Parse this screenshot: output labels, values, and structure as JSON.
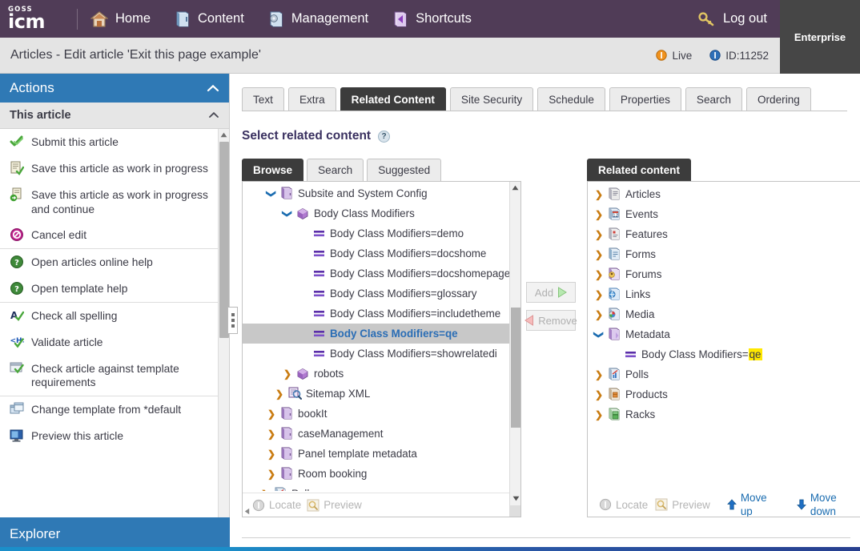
{
  "brand": {
    "line1": "GOSS",
    "line2": "icm"
  },
  "topnav": {
    "items": [
      {
        "label": "Home",
        "icon": "home-icon"
      },
      {
        "label": "Content",
        "icon": "content-book-icon"
      },
      {
        "label": "Management",
        "icon": "management-gear-icon"
      },
      {
        "label": "Shortcuts",
        "icon": "shortcuts-arrow-icon"
      }
    ],
    "logout": {
      "label": "Log out",
      "icon": "key-icon"
    },
    "edition": "Enterprise"
  },
  "titlebar": {
    "title": "Articles - Edit article 'Exit this page example'",
    "status": {
      "label": "Live",
      "icon": "live-info-icon"
    },
    "id": {
      "label": "ID:11252",
      "icon": "id-info-icon"
    }
  },
  "sidebar": {
    "header": "Actions",
    "group_header": "This article",
    "footer_header": "Explorer",
    "items": [
      {
        "label": "Submit this article",
        "icon": "green-check-icon",
        "divider_before": false
      },
      {
        "label": "Save this article as work in progress",
        "icon": "save-wip-icon",
        "divider_before": false
      },
      {
        "label": "Save this article as work in progress and continue",
        "icon": "save-wip-continue-icon",
        "divider_before": false
      },
      {
        "label": "Cancel edit",
        "icon": "cancel-icon",
        "divider_before": false
      },
      {
        "label": "Open articles online help",
        "icon": "help-icon",
        "divider_before": true
      },
      {
        "label": "Open template help",
        "icon": "help-icon",
        "divider_before": false
      },
      {
        "label": "Check all spelling",
        "icon": "spellcheck-icon",
        "divider_before": true
      },
      {
        "label": "Validate article",
        "icon": "validate-html-icon",
        "divider_before": false
      },
      {
        "label": "Check article against template requirements",
        "icon": "template-check-icon",
        "divider_before": false
      },
      {
        "label": "Change template from *default",
        "icon": "change-template-icon",
        "divider_before": true
      },
      {
        "label": "Preview this article",
        "icon": "preview-monitor-icon",
        "divider_before": false
      }
    ]
  },
  "main": {
    "tabs": [
      {
        "label": "Text",
        "active": false
      },
      {
        "label": "Extra",
        "active": false
      },
      {
        "label": "Related Content",
        "active": true
      },
      {
        "label": "Site Security",
        "active": false
      },
      {
        "label": "Schedule",
        "active": false
      },
      {
        "label": "Properties",
        "active": false
      },
      {
        "label": "Search",
        "active": false
      },
      {
        "label": "Ordering",
        "active": false
      }
    ],
    "section_title": "Select related content",
    "help_marker": "?",
    "browse_tabs": [
      {
        "label": "Browse",
        "active": true
      },
      {
        "label": "Search",
        "active": false
      },
      {
        "label": "Suggested",
        "active": false
      }
    ],
    "browse_tree": [
      {
        "label": "Subsite and System Config",
        "indent": 1,
        "caret": "down",
        "icon": "folder-door-icon",
        "selected": false
      },
      {
        "label": "Body Class Modifiers",
        "indent": 2,
        "caret": "down",
        "icon": "metadata-cube-icon",
        "selected": false
      },
      {
        "label": "Body Class Modifiers=demo",
        "indent": 3,
        "caret": "none",
        "icon": "metadata-value-icon",
        "selected": false
      },
      {
        "label": "Body Class Modifiers=docshome",
        "indent": 3,
        "caret": "none",
        "icon": "metadata-value-icon",
        "selected": false
      },
      {
        "label": "Body Class Modifiers=docshomepage",
        "indent": 3,
        "caret": "none",
        "icon": "metadata-value-icon",
        "selected": false
      },
      {
        "label": "Body Class Modifiers=glossary",
        "indent": 3,
        "caret": "none",
        "icon": "metadata-value-icon",
        "selected": false
      },
      {
        "label": "Body Class Modifiers=includetheme",
        "indent": 3,
        "caret": "none",
        "icon": "metadata-value-icon",
        "selected": false
      },
      {
        "label": "Body Class Modifiers=qe",
        "indent": 3,
        "caret": "none",
        "icon": "metadata-value-icon",
        "selected": true
      },
      {
        "label": "Body Class Modifiers=showrelatedi",
        "indent": 3,
        "caret": "none",
        "icon": "metadata-value-icon",
        "selected": false
      },
      {
        "label": "robots",
        "indent": 2,
        "caret": "right",
        "icon": "metadata-cube-icon",
        "selected": false
      },
      {
        "label": "Sitemap XML",
        "indent": 1.5,
        "caret": "right",
        "icon": "sitemap-icon",
        "selected": false
      },
      {
        "label": "bookIt",
        "indent": 1,
        "caret": "right",
        "icon": "folder-door-icon",
        "selected": false
      },
      {
        "label": "caseManagement",
        "indent": 1,
        "caret": "right",
        "icon": "folder-door-icon",
        "selected": false
      },
      {
        "label": "Panel template metadata",
        "indent": 1,
        "caret": "right",
        "icon": "folder-door-icon",
        "selected": false
      },
      {
        "label": "Room booking",
        "indent": 1,
        "caret": "right",
        "icon": "folder-door-icon",
        "selected": false
      },
      {
        "label": "Polls",
        "indent": 0.6,
        "caret": "right",
        "icon": "polls-icon",
        "selected": false
      }
    ],
    "browse_footer": [
      {
        "label": "Locate",
        "icon": "locate-icon",
        "enabled": false
      },
      {
        "label": "Preview",
        "icon": "preview-icon",
        "enabled": false
      }
    ],
    "transfer": [
      {
        "label": "Add",
        "icon": "arrow-right-icon",
        "enabled": false
      },
      {
        "label": "Remove",
        "icon": "arrow-left-icon",
        "enabled": false
      }
    ],
    "related_tab": "Related content",
    "related_tree": [
      {
        "label": "Articles",
        "indent": 0,
        "caret": "right",
        "icon": "articles-icon",
        "highlight": ""
      },
      {
        "label": "Events",
        "indent": 0,
        "caret": "right",
        "icon": "events-icon",
        "highlight": ""
      },
      {
        "label": "Features",
        "indent": 0,
        "caret": "right",
        "icon": "features-icon",
        "highlight": ""
      },
      {
        "label": "Forms",
        "indent": 0,
        "caret": "right",
        "icon": "forms-icon",
        "highlight": ""
      },
      {
        "label": "Forums",
        "indent": 0,
        "caret": "right",
        "icon": "forums-icon",
        "highlight": ""
      },
      {
        "label": "Links",
        "indent": 0,
        "caret": "right",
        "icon": "links-icon",
        "highlight": ""
      },
      {
        "label": "Media",
        "indent": 0,
        "caret": "right",
        "icon": "media-icon",
        "highlight": ""
      },
      {
        "label": "Metadata",
        "indent": 0,
        "caret": "down",
        "icon": "metadata-folder-icon",
        "highlight": ""
      },
      {
        "label": "Body Class Modifiers=",
        "indent": 1,
        "caret": "none",
        "icon": "metadata-value-icon",
        "highlight": "qe"
      },
      {
        "label": "Polls",
        "indent": 0,
        "caret": "right",
        "icon": "polls-icon",
        "highlight": ""
      },
      {
        "label": "Products",
        "indent": 0,
        "caret": "right",
        "icon": "products-icon",
        "highlight": ""
      },
      {
        "label": "Racks",
        "indent": 0,
        "caret": "right",
        "icon": "racks-icon",
        "highlight": ""
      }
    ],
    "related_footer": [
      {
        "label": "Locate",
        "icon": "locate-icon",
        "enabled": false
      },
      {
        "label": "Preview",
        "icon": "preview-icon",
        "enabled": false
      },
      {
        "label": "Move up",
        "icon": "arrow-up-icon",
        "enabled": true
      },
      {
        "label": "Move down",
        "icon": "arrow-down-icon",
        "enabled": true
      }
    ]
  },
  "colors": {
    "topnav": "#503c57",
    "accent_blue": "#2f79b5",
    "active_tab": "#3c3c3c",
    "highlight": "#ffe800",
    "selected_row": "#c8c8c8",
    "selected_text": "#2a6db5",
    "enterprise_bg": "#464646"
  }
}
